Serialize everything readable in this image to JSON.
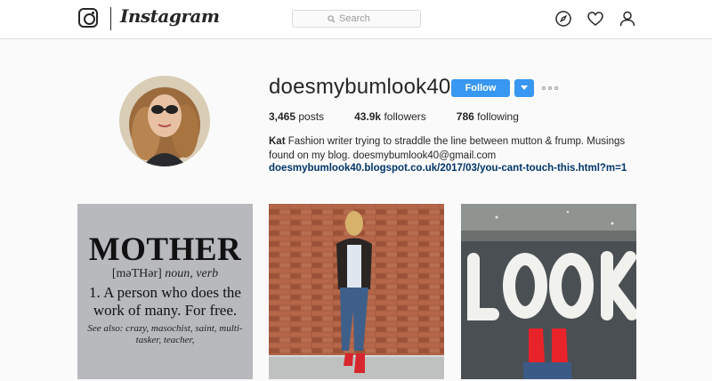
{
  "nav": {
    "brand": "Instagram",
    "search_placeholder": "Search",
    "icons": [
      "instagram-camera-icon",
      "search-icon",
      "compass-icon",
      "heart-icon",
      "person-icon"
    ]
  },
  "profile": {
    "username": "doesmybumlook40",
    "follow_label": "Follow",
    "stats": {
      "posts_count": "3,465",
      "posts_label": "posts",
      "followers_count": "43.9k",
      "followers_label": "followers",
      "following_count": "786",
      "following_label": "following"
    },
    "bio_name": "Kat",
    "bio_text": "Fashion writer trying to straddle the line between mutton & frump. Musings found on my blog. doesmybumlook40@gmail.com",
    "link": "doesmybumlook40.blogspot.co.uk/2017/03/you-cant-touch-this.html?m=1"
  },
  "posts": [
    {
      "word": "MOTHER",
      "pronunciation": "[məTHər]",
      "pos": "noun, verb",
      "definition": "1. A person who does the work of many. For free.",
      "see_also": "See also: crazy, masochist, saint, multi-tasker, teacher,"
    },
    {
      "caption": ""
    },
    {
      "painted_text": "LOOK"
    }
  ],
  "colors": {
    "accent": "#3897f0",
    "link": "#003569",
    "border": "#dbdbdb",
    "background": "#fafafa"
  }
}
